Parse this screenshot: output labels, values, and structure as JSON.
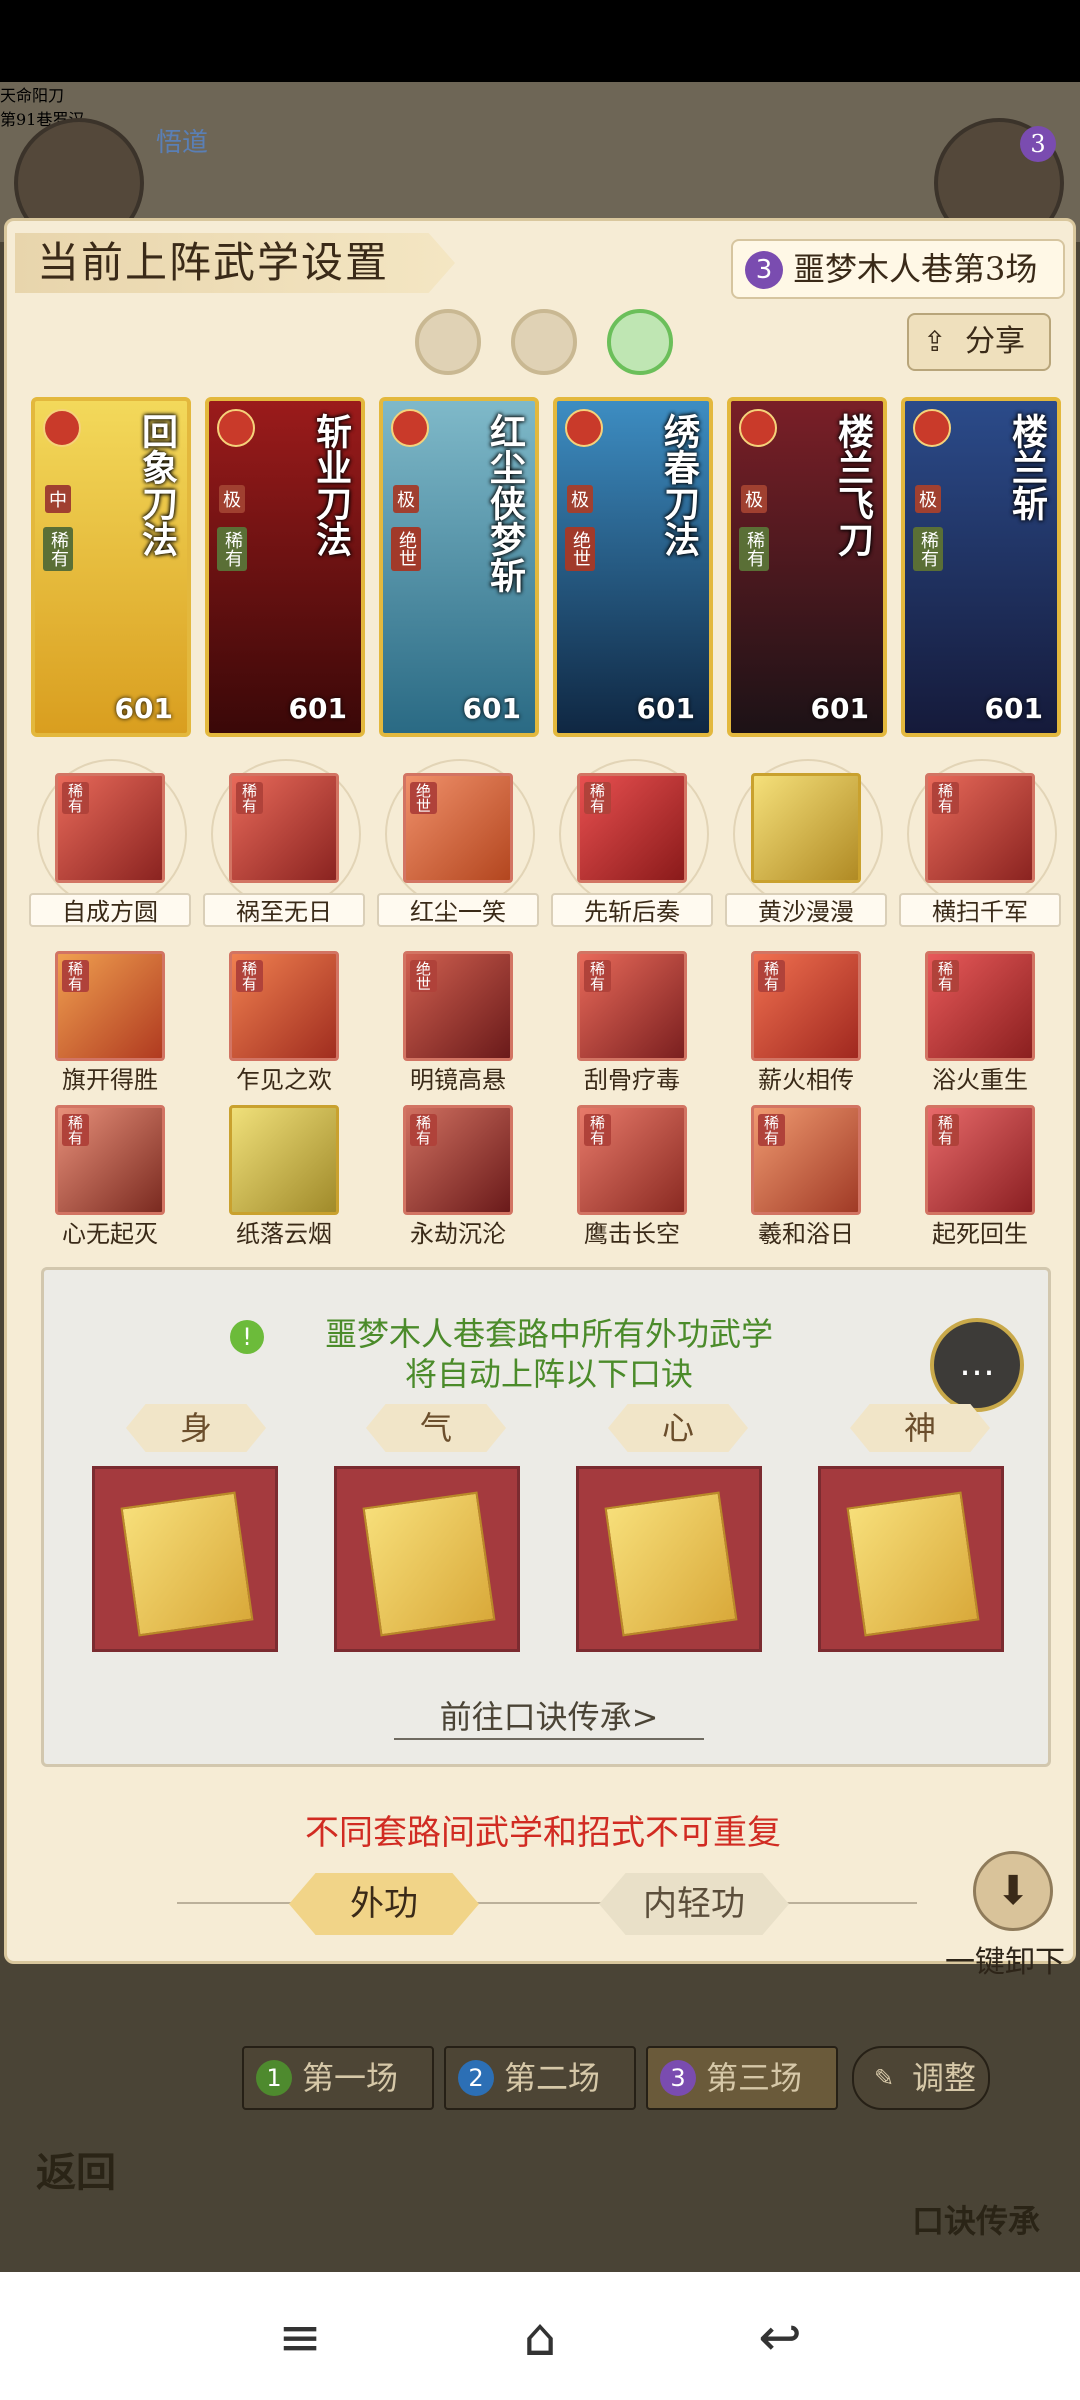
{
  "background": {
    "player_left": "天命阳刀",
    "player_left_tag": "悟道",
    "player_right": "第91巷罗汉",
    "player_right_level": "3"
  },
  "panel": {
    "title": "当前上阵武学设置",
    "match_badge_num": "3",
    "match_badge": "噩梦木人巷第3场",
    "share_label": "分享",
    "share_icon": "share-icon"
  },
  "cards": [
    {
      "name": "回象刀法",
      "grade": "中",
      "rarity": "稀有",
      "power": "601"
    },
    {
      "name": "斩业刀法",
      "grade": "极",
      "rarity": "稀有",
      "power": "601"
    },
    {
      "name": "红尘侠梦斩",
      "grade": "极",
      "rarity": "绝世",
      "power": "601"
    },
    {
      "name": "绣春刀法",
      "grade": "极",
      "rarity": "绝世",
      "power": "601"
    },
    {
      "name": "楼兰飞刀",
      "grade": "极",
      "rarity": "稀有",
      "power": "601"
    },
    {
      "name": "楼兰斩",
      "grade": "极",
      "rarity": "稀有",
      "power": "601"
    }
  ],
  "skills_row1": [
    {
      "label": "自成方圆",
      "tag": "稀有"
    },
    {
      "label": "祸至无日",
      "tag": "稀有"
    },
    {
      "label": "红尘一笑",
      "tag": "绝世"
    },
    {
      "label": "先斩后奏",
      "tag": "稀有"
    },
    {
      "label": "黄沙漫漫",
      "tag": ""
    },
    {
      "label": "横扫千军",
      "tag": "稀有"
    }
  ],
  "skills_row2": [
    {
      "label": "旗开得胜",
      "tag": "稀有"
    },
    {
      "label": "乍见之欢",
      "tag": "稀有"
    },
    {
      "label": "明镜高悬",
      "tag": "绝世"
    },
    {
      "label": "刮骨疗毒",
      "tag": "稀有"
    },
    {
      "label": "薪火相传",
      "tag": "稀有"
    },
    {
      "label": "浴火重生",
      "tag": "稀有"
    }
  ],
  "skills_row3": [
    {
      "label": "心无起灭",
      "tag": "稀有"
    },
    {
      "label": "纸落云烟",
      "tag": ""
    },
    {
      "label": "永劫沉沦",
      "tag": "稀有"
    },
    {
      "label": "鹰击长空",
      "tag": "稀有"
    },
    {
      "label": "羲和浴日",
      "tag": "稀有"
    },
    {
      "label": "起死回生",
      "tag": "稀有"
    }
  ],
  "info": {
    "line1": "噩梦木人巷套路中所有外功武学",
    "line2": "将自动上阵以下口诀",
    "slots": [
      "身",
      "气",
      "心",
      "神"
    ],
    "goto": "前往口诀传承>"
  },
  "warning": "不同套路间武学和招式不可重复",
  "tabs": {
    "waigong": "外功",
    "neiqing": "内轻功"
  },
  "unload": "一键卸下",
  "match_buttons": [
    {
      "num": "1",
      "label": "第一场",
      "color": "#4e8a2e"
    },
    {
      "num": "2",
      "label": "第二场",
      "color": "#2c6fb5"
    },
    {
      "num": "3",
      "label": "第三场",
      "color": "#7a4cb0"
    }
  ],
  "adjust": "调整",
  "back": "返回",
  "inherit": "口诀传承"
}
